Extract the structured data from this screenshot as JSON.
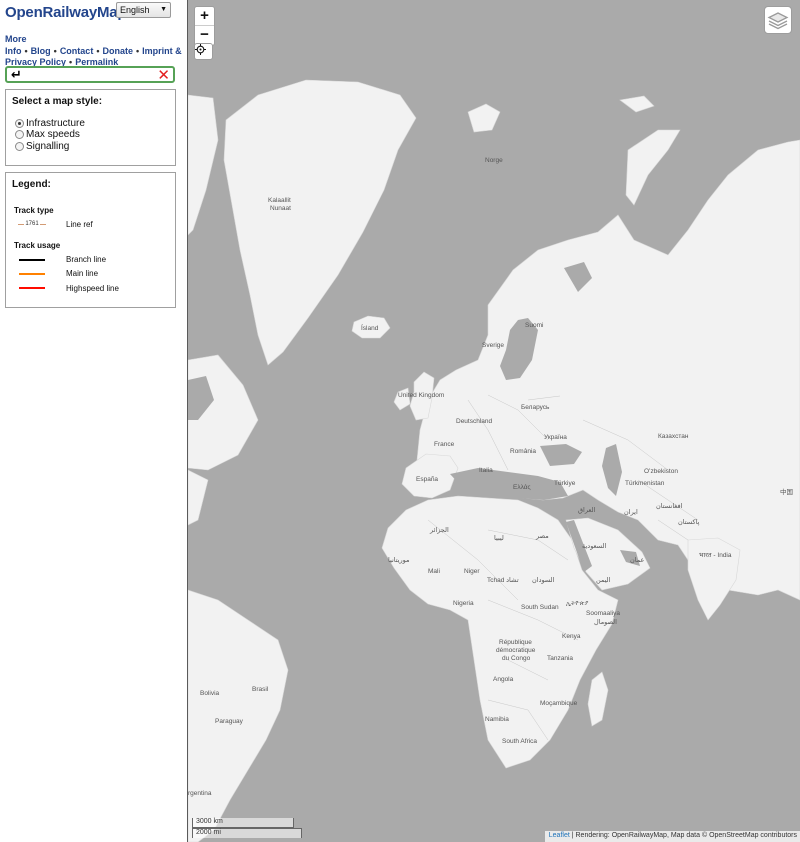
{
  "header": {
    "brand": "OpenRailwayMap",
    "language": "English"
  },
  "nav_links": {
    "more_info": "More Info",
    "blog": "Blog",
    "contact": "Contact",
    "donate": "Donate",
    "imprint": "Imprint &",
    "privacy": "Privacy Policy",
    "permalink": "Permalink"
  },
  "search": {
    "value": "↵"
  },
  "style_panel": {
    "title": "Select a map style:",
    "options": [
      "Infrastructure",
      "Max speeds",
      "Signalling"
    ],
    "selected": "Infrastructure"
  },
  "legend": {
    "title": "Legend:",
    "track_type_heading": "Track type",
    "line_ref_sample": "1761",
    "line_ref_label": "Line ref",
    "track_usage_heading": "Track usage",
    "items": [
      {
        "label": "Branch line",
        "color": "#000000"
      },
      {
        "label": "Main line",
        "color": "#ff8100"
      },
      {
        "label": "Highspeed line",
        "color": "#ff0c00"
      }
    ]
  },
  "map": {
    "zoom_in": "+",
    "zoom_out": "−",
    "scale_km": "3000 km",
    "scale_mi": "2000 mi",
    "attribution_link": "Leaflet",
    "attribution_text": " | Rendering: OpenRailwayMap, Map data © OpenStreetMap contributors",
    "colors": {
      "water": "#aaaaaa",
      "land": "#f2f2f2"
    },
    "labels": {
      "kalaallit1": "Kalaallit",
      "kalaallit2": "Nunaat",
      "island": "Ísland",
      "norge": "Norge",
      "suomi": "Suomi",
      "sverige": "Sverige",
      "uk": "United Kingdom",
      "deutschland": "Deutschland",
      "belarus": "Беларусь",
      "ukraina": "Україна",
      "france": "France",
      "romania": "România",
      "kazakhstan": "Казахстан",
      "espana": "España",
      "italia": "Italia",
      "ellas": "Ελλάς",
      "turkiye": "Türkiye",
      "uzbekiston": "Oʻzbekiston",
      "turkmenistan": "Türkmenistan",
      "china": "中国",
      "iraq": "العراق",
      "iran": "ایران",
      "afghanistan": "افغانستان",
      "pakistan": "پاکستان",
      "algeria": "الجزائر",
      "libya": "ليبيا",
      "egypt": "مصر",
      "saudi": "السعودية",
      "mauritania": "موريتانيا",
      "india": "भारत - India",
      "oman": "عمان",
      "mali": "Mali",
      "niger": "Niger",
      "tchad": "Tchad تشاد",
      "sudan": "السودان",
      "yemen": "اليمن",
      "nigeria": "Nigeria",
      "south_sudan": "South Sudan",
      "ethiopia": "ኢትዮጵያ",
      "somalia1": "Soomaaliya",
      "somalia2": "الصومال",
      "drc1": "République",
      "drc2": "démocratique",
      "drc3": "du Congo",
      "kenya": "Kenya",
      "tanzania": "Tanzania",
      "angola": "Angola",
      "brasil": "Brasil",
      "bolivia": "Bolivia",
      "paraguay": "Paraguay",
      "namibia": "Namibia",
      "mocambique": "Moçambique",
      "south_africa": "South Africa",
      "argentina": "rgentina"
    }
  }
}
